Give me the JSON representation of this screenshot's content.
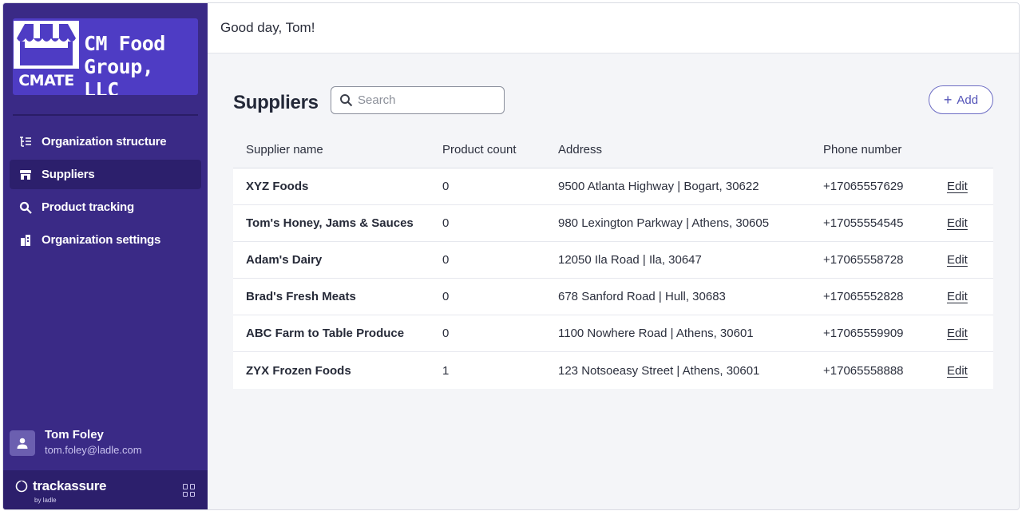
{
  "sidebar": {
    "logo": {
      "badge": "CMATE",
      "name": "CM Food\nGroup, LLC"
    },
    "items": [
      {
        "label": "Organization structure",
        "icon": "org-structure-icon",
        "active": false
      },
      {
        "label": "Suppliers",
        "icon": "store-icon",
        "active": true
      },
      {
        "label": "Product tracking",
        "icon": "search-icon",
        "active": false
      },
      {
        "label": "Organization settings",
        "icon": "building-icon",
        "active": false
      }
    ],
    "user": {
      "name": "Tom Foley",
      "email": "tom.foley@ladle.com"
    },
    "brand": {
      "name": "trackassure",
      "sub": "by ladle"
    }
  },
  "header": {
    "greeting": "Good day, Tom!"
  },
  "main": {
    "title": "Suppliers",
    "search": {
      "placeholder": "Search",
      "value": ""
    },
    "add_label": "Add",
    "columns": [
      "Supplier name",
      "Product count",
      "Address",
      "Phone number"
    ],
    "rows": [
      {
        "name": "XYZ Foods",
        "count": "0",
        "address": "9500 Atlanta Highway | Bogart, 30622",
        "phone": "+17065557629",
        "action": "Edit"
      },
      {
        "name": "Tom's Honey, Jams & Sauces",
        "count": "0",
        "address": "980 Lexington Parkway | Athens, 30605",
        "phone": "+17055554545",
        "action": "Edit"
      },
      {
        "name": "Adam's Dairy",
        "count": "0",
        "address": "12050 Ila Road | Ila, 30647",
        "phone": "+17065558728",
        "action": "Edit"
      },
      {
        "name": "Brad's Fresh Meats",
        "count": "0",
        "address": "678 Sanford Road | Hull, 30683",
        "phone": "+17065552828",
        "action": "Edit"
      },
      {
        "name": "ABC Farm to Table Produce",
        "count": "0",
        "address": "1100 Nowhere Road | Athens, 30601",
        "phone": "+17065559909",
        "action": "Edit"
      },
      {
        "name": "ZYX Frozen Foods",
        "count": "1",
        "address": "123 Notsoeasy Street | Athens, 30601",
        "phone": "+17065558888",
        "action": "Edit"
      }
    ]
  },
  "colors": {
    "sidebar_bg": "#3a2a86",
    "sidebar_active": "#2c1f6c",
    "logo_bg": "#4e3cc4",
    "accent": "#5353b8",
    "page_bg": "#f4f5f8"
  }
}
